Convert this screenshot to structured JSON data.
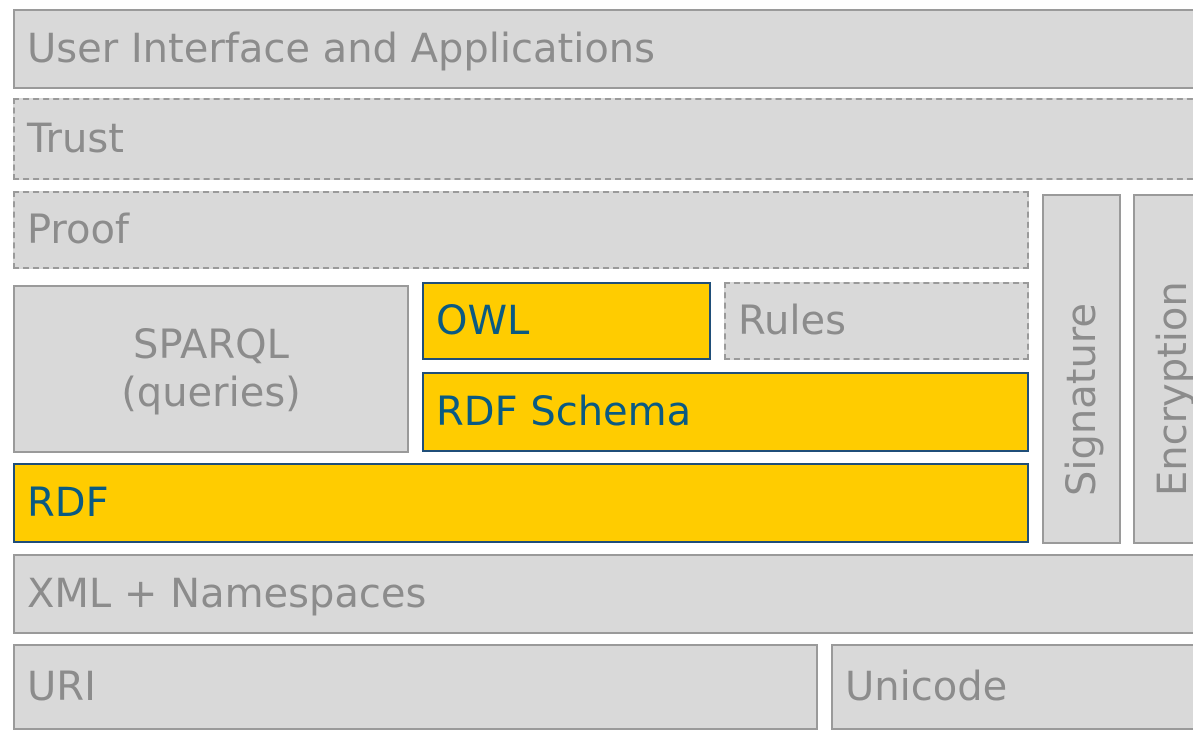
{
  "layers": {
    "ui": "User Interface and Applications",
    "trust": "Trust",
    "proof": "Proof",
    "sparql_line1": "SPARQL",
    "sparql_line2": "(queries)",
    "owl": "OWL",
    "rules": "Rules",
    "rdf_schema": "RDF Schema",
    "rdf": "RDF",
    "signature": "Signature",
    "encryption": "Encryption",
    "xml": "XML + Namespaces",
    "uri": "URI",
    "unicode": "Unicode"
  },
  "colors": {
    "layer_fill": "#d9d9d9",
    "layer_border": "#9a9a9a",
    "layer_text": "#8c8c8c",
    "highlight_fill": "#ffcc00",
    "highlight_text": "#0a5a82"
  }
}
